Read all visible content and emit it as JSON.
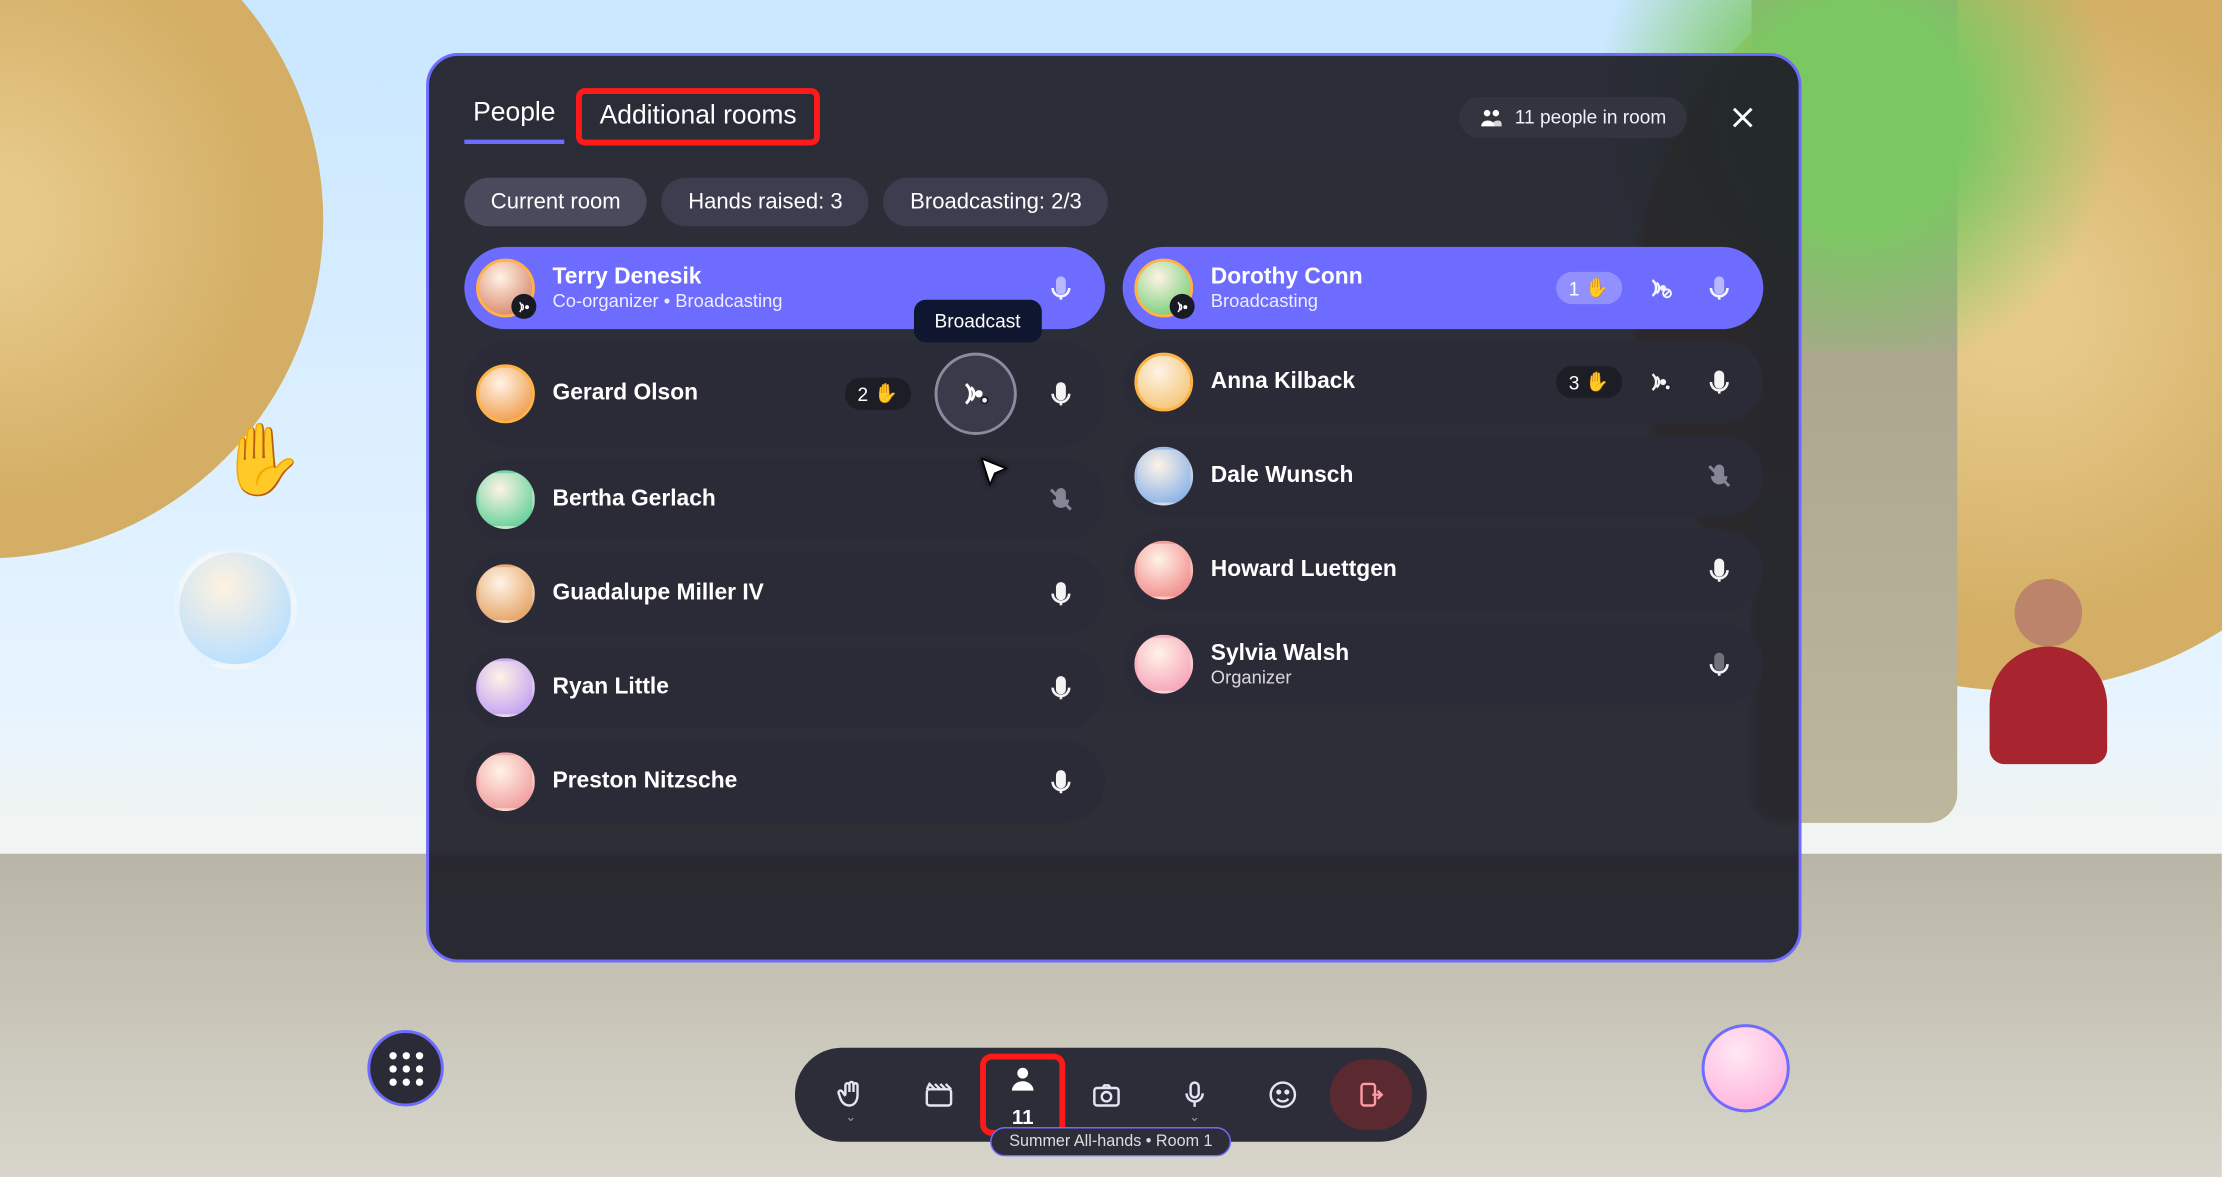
{
  "header": {
    "tab_people": "People",
    "tab_rooms": "Additional rooms",
    "room_count_label": "11 people in room"
  },
  "filters": {
    "current_room": "Current room",
    "hands_raised": "Hands raised: 3",
    "broadcasting": "Broadcasting: 2/3"
  },
  "tooltip_broadcast": "Broadcast",
  "left_col": [
    {
      "name": "Terry Denesik",
      "sub": "Co-organizer • Broadcasting",
      "accent": true,
      "avatar": "#d98b6d",
      "ring": true,
      "badge": true,
      "mic": "dim"
    },
    {
      "name": "Gerard Olson",
      "hand": "2",
      "avatar": "#f0a050",
      "ring": true,
      "hover_broadcast": true,
      "mic": "on"
    },
    {
      "name": "Bertha Gerlach",
      "avatar": "#6bd39d",
      "mic": "muted"
    },
    {
      "name": "Guadalupe Miller IV",
      "avatar": "#e6a76b",
      "mic": "on"
    },
    {
      "name": "Ryan Little",
      "avatar": "#c6a6f2",
      "mic": "on"
    },
    {
      "name": "Preston Nitzsche",
      "avatar": "#f2a2a2",
      "mic": "on"
    }
  ],
  "right_col": [
    {
      "name": "Dorothy Conn",
      "sub": "Broadcasting",
      "accent": true,
      "avatar": "#7dd07d",
      "ring": true,
      "badge": true,
      "hand": "1",
      "broadcast_icon": true,
      "mic": "dim"
    },
    {
      "name": "Anna Kilback",
      "avatar": "#f4c77a",
      "ring": true,
      "hand": "3",
      "broadcast_icon": true,
      "mic": "on"
    },
    {
      "name": "Dale Wunsch",
      "avatar": "#8fb5e8",
      "mic": "muted"
    },
    {
      "name": "Howard Luettgen",
      "avatar": "#f29292",
      "mic": "on"
    },
    {
      "name": "Sylvia Walsh",
      "sub": "Organizer",
      "avatar": "#f7a7bb",
      "mic": "dim2"
    }
  ],
  "toolbar": {
    "people_count": "11"
  },
  "session_label": "Summer All-hands • Room 1"
}
